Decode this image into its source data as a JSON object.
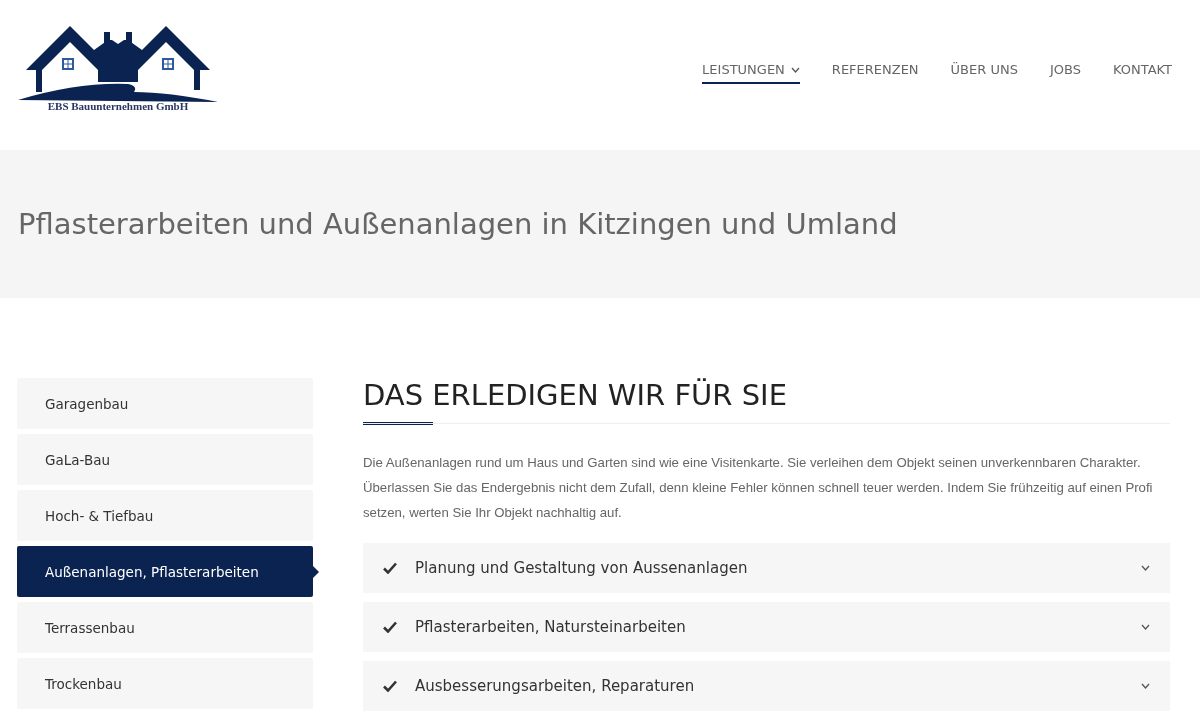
{
  "logo": {
    "company": "EBS Bauunternehmen GmbH"
  },
  "nav": [
    {
      "label": "LEISTUNGEN",
      "selected": true,
      "dropdown": true
    },
    {
      "label": "REFERENZEN",
      "selected": false,
      "dropdown": false
    },
    {
      "label": "ÜBER UNS",
      "selected": false,
      "dropdown": false
    },
    {
      "label": "JOBS",
      "selected": false,
      "dropdown": false
    },
    {
      "label": "KONTAKT",
      "selected": false,
      "dropdown": false
    }
  ],
  "page_title": "Pflasterarbeiten und Außenanlagen in Kitzingen und Umland",
  "sidebar": {
    "items": [
      {
        "label": "Garagenbau",
        "selected": false
      },
      {
        "label": "GaLa-Bau",
        "selected": false
      },
      {
        "label": "Hoch- & Tiefbau",
        "selected": false
      },
      {
        "label": "Außenanlagen, Pflasterarbeiten",
        "selected": true
      },
      {
        "label": "Terrassenbau",
        "selected": false
      },
      {
        "label": "Trockenbau",
        "selected": false
      }
    ]
  },
  "content": {
    "heading": "DAS ERLEDIGEN WIR FÜR SIE",
    "intro": "Die Außenanlagen rund um Haus und Garten sind wie eine Visitenkarte. Sie verleihen dem Objekt seinen unverkennbaren Charakter. Überlassen Sie das Endergebnis nicht dem Zufall, denn kleine Fehler können schnell teuer werden. Indem Sie frühzeitig auf einen Profi setzen, werten Sie Ihr Objekt nachhaltig auf.",
    "accordion": [
      {
        "title": "Planung und Gestaltung von Aussenanlagen",
        "expanded": false
      },
      {
        "title": "Pflasterarbeiten, Natursteinarbeiten",
        "expanded": false
      },
      {
        "title": "Ausbesserungsarbeiten, Reparaturen",
        "expanded": false
      }
    ]
  }
}
